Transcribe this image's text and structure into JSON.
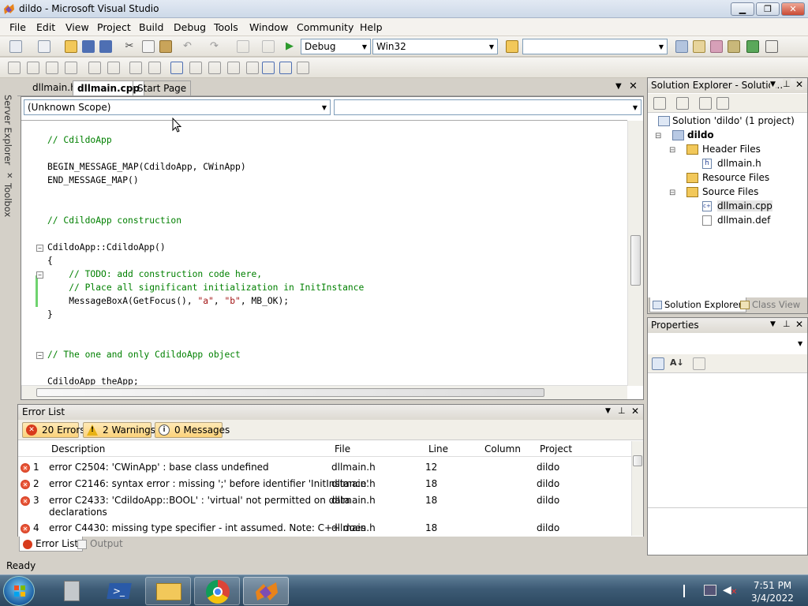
{
  "window": {
    "title": "dildo - Microsoft Visual Studio",
    "minimize": "▁",
    "maximize": "❐",
    "close": "✕"
  },
  "menu": [
    "File",
    "Edit",
    "View",
    "Project",
    "Build",
    "Debug",
    "Tools",
    "Window",
    "Community",
    "Help"
  ],
  "toolbar": {
    "config": "Debug",
    "platform": "Win32",
    "find_value": ""
  },
  "sidebar": {
    "server_explorer": "Server Explorer",
    "toolbox": "Toolbox"
  },
  "editor_tabs": [
    "dllmain.h",
    "dllmain.cpp",
    "Start Page"
  ],
  "editor": {
    "scope": "(Unknown Scope)",
    "member": "",
    "lines": {
      "l1": "// CdildoApp",
      "l2": "BEGIN_MESSAGE_MAP(CdildoApp, CWinApp)",
      "l3": "END_MESSAGE_MAP()",
      "l4": "// CdildoApp construction",
      "l5": "CdildoApp::CdildoApp()",
      "l6": "{",
      "l7": "    // TODO: add construction code here,",
      "l8": "    // Place all significant initialization in InitInstance",
      "l9a": "    MessageBoxA(GetFocus(), ",
      "l9b": "\"a\"",
      "l9c": ", ",
      "l9d": "\"b\"",
      "l9e": ", MB_OK);",
      "l10": "}",
      "l11": "// The one and only CdildoApp object",
      "l12": "CdildoApp theApp;"
    }
  },
  "error_list": {
    "title": "Error List",
    "filters": {
      "errors": "20 Errors",
      "warnings": "2 Warnings",
      "messages": "0 Messages"
    },
    "columns": [
      "Description",
      "File",
      "Line",
      "Column",
      "Project"
    ],
    "rows": [
      {
        "num": "1",
        "desc": "error C2504: 'CWinApp' : base class undefined",
        "desc2": "",
        "file": "dllmain.h",
        "line": "12",
        "col": "",
        "project": "dildo"
      },
      {
        "num": "2",
        "desc": "error C2146: syntax error : missing ';' before identifier 'InitInstance'",
        "desc2": "",
        "file": "dllmain.h",
        "line": "18",
        "col": "",
        "project": "dildo"
      },
      {
        "num": "3",
        "desc": "error C2433: 'CdildoApp::BOOL' : 'virtual' not permitted on data",
        "desc2": "declarations",
        "file": "dllmain.h",
        "line": "18",
        "col": "",
        "project": "dildo"
      },
      {
        "num": "4",
        "desc": "error C4430: missing type specifier - int assumed. Note: C++ does",
        "desc2": "",
        "file": "dllmain.h",
        "line": "18",
        "col": "",
        "project": "dildo"
      }
    ]
  },
  "bottom_tabs": [
    "Error List",
    "Output"
  ],
  "solution_explorer": {
    "title": "Solution Explorer - Solutio...",
    "solution": "Solution 'dildo' (1 project)",
    "project": "dildo",
    "header_files": "Header Files",
    "dllmain_h": "dllmain.h",
    "resource_files": "Resource Files",
    "source_files": "Source Files",
    "dllmain_cpp": "dllmain.cpp",
    "dllmain_def": "dllmain.def",
    "tab_solution": "Solution Explorer",
    "tab_class": "Class View"
  },
  "properties": {
    "title": "Properties"
  },
  "status": {
    "text": "Ready"
  },
  "taskbar": {
    "time": "7:51 PM",
    "date": "3/4/2022"
  }
}
